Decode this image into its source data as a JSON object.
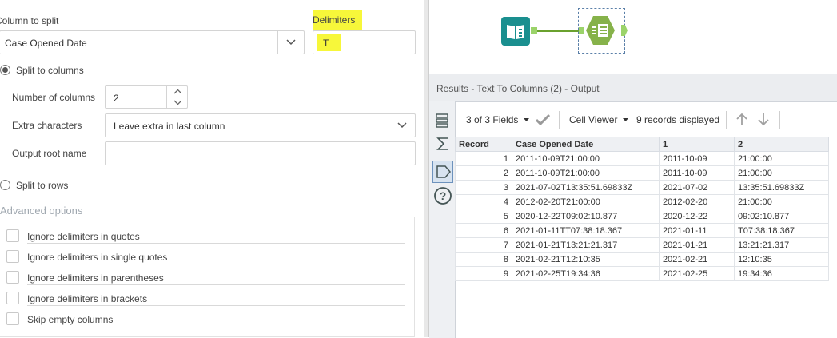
{
  "config": {
    "column_to_split_label": "Column to split",
    "column_to_split_value": "Case Opened Date",
    "delimiters_label": "Delimiters",
    "delimiters_value": "T",
    "split_to_columns_label": "Split to columns",
    "split_to_columns_selected": true,
    "number_of_columns_label": "Number of columns",
    "number_of_columns_value": "2",
    "extra_characters_label": "Extra characters",
    "extra_characters_value": "Leave extra in last column",
    "output_root_name_label": "Output root name",
    "output_root_name_value": "",
    "split_to_rows_label": "Split to rows",
    "split_to_rows_selected": false,
    "advanced_options_label": "Advanced options",
    "options": [
      {
        "label": "Ignore delimiters in quotes",
        "checked": false
      },
      {
        "label": "Ignore delimiters in single quotes",
        "checked": false
      },
      {
        "label": "Ignore delimiters in parentheses",
        "checked": false
      },
      {
        "label": "Ignore delimiters in brackets",
        "checked": false
      },
      {
        "label": "Skip empty columns",
        "checked": false
      }
    ]
  },
  "canvas": {
    "tools": [
      "input-data-tool-icon",
      "text-to-columns-tool-icon"
    ],
    "input_tool_color": "#1a8f8f",
    "parse_tool_color": "#86b24a",
    "connector_color": "#6aa12e"
  },
  "results": {
    "header_title": "Results - Text To Columns (2) - Output",
    "fields_label": "3 of 3 Fields",
    "cell_viewer_label": "Cell Viewer",
    "records_label": "9 records displayed",
    "columns": [
      "Record",
      "Case Opened Date",
      "1",
      "2"
    ],
    "rows": [
      [
        "1",
        "2011-10-09T21:00:00",
        "2011-10-09",
        "21:00:00"
      ],
      [
        "2",
        "2011-10-09T21:00:00",
        "2011-10-09",
        "21:00:00"
      ],
      [
        "3",
        "2021-07-02T13:35:51.69833Z",
        "2021-07-02",
        "13:35:51.69833Z"
      ],
      [
        "4",
        "2012-02-20T21:00:00",
        "2012-02-20",
        "21:00:00"
      ],
      [
        "5",
        "2020-12-22T09:02:10.877",
        "2020-12-22",
        "09:02:10.877"
      ],
      [
        "6",
        "2021-01-11TT07:38:18.367",
        "2021-01-11",
        "T07:38:18.367"
      ],
      [
        "7",
        "2021-01-21T13:21:21.317",
        "2021-01-21",
        "13:21:21.317"
      ],
      [
        "8",
        "2021-02-21T12:10:35",
        "2021-02-21",
        "12:10:35"
      ],
      [
        "9",
        "2021-02-25T19:34:36",
        "2021-02-25",
        "19:34:36"
      ]
    ]
  }
}
